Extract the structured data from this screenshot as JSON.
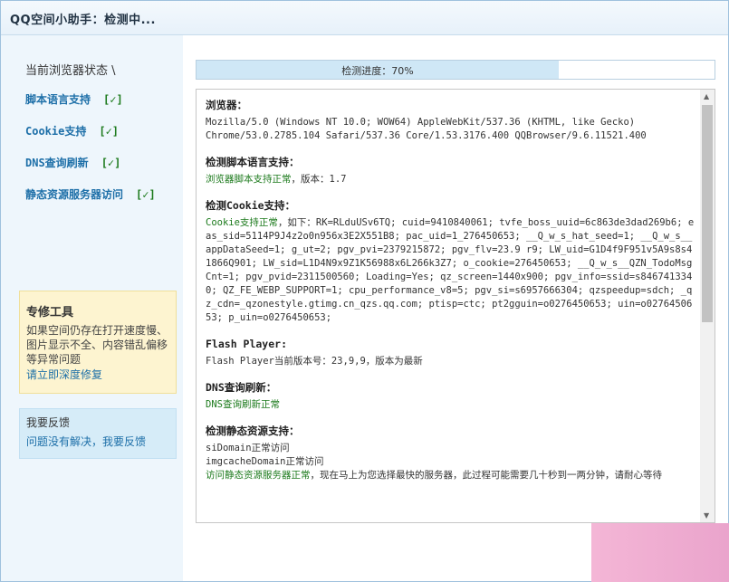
{
  "window": {
    "title": "QQ空间小助手：检测中..."
  },
  "sidebar": {
    "header": "当前浏览器状态 \\",
    "items": [
      {
        "label": "脚本语言支持",
        "status": "[✓]"
      },
      {
        "label": "Cookie支持",
        "status": "[✓]"
      },
      {
        "label": "DNS查询刷新",
        "status": "[✓]"
      },
      {
        "label": "静态资源服务器访问",
        "status": "[✓]"
      }
    ],
    "tools_box": {
      "title": "专修工具",
      "desc": "如果空间仍存在打开速度慢、图片显示不全、内容错乱偏移等异常问题",
      "link": "请立即深度修复"
    },
    "feedback_box": {
      "title": "我要反馈",
      "link": "问题没有解决，我要反馈"
    }
  },
  "progress": {
    "label": "检测进度：70%",
    "value": 0.7
  },
  "report": {
    "browser": {
      "heading": "浏览器：",
      "line1": "Mozilla/5.0 (Windows NT 10.0; WOW64) AppleWebKit/537.36 (KHTML, like Gecko)",
      "line2": "Chrome/53.0.2785.104 Safari/537.36 Core/1.53.3176.400 QQBrowser/9.6.11521.400"
    },
    "script": {
      "heading": "检测脚本语言支持：",
      "ok": "浏览器脚本支持正常",
      "rest": "，版本：1.7"
    },
    "cookie": {
      "heading": "检测Cookie支持：",
      "ok": "Cookie支持正常",
      "rest": "，如下：RK=RLduUSv6TQ; cuid=9410840061; tvfe_boss_uuid=6c863de3dad269b6; eas_sid=5114P9J4z2o0n956x3E2X551B8; pac_uid=1_276450653; __Q_w_s_hat_seed=1; __Q_w_s__appDataSeed=1; g_ut=2; pgv_pvi=2379215872; pgv_flv=23.9 r9; LW_uid=G1D4f9F951v5A9s8s41866Q901; LW_sid=L1D4N9x9Z1K56988x6L266k3Z7; o_cookie=276450653; __Q_w_s__QZN_TodoMsgCnt=1; pgv_pvid=2311500560; Loading=Yes; qz_screen=1440x900; pgv_info=ssid=s8467413340; QZ_FE_WEBP_SUPPORT=1; cpu_performance_v8=5; pgv_si=s6957666304; qzspeedup=sdch; _qz_cdn=_qzonestyle.gtimg.cn_qzs.qq.com; ptisp=ctc; pt2gguin=o0276450653; uin=o0276450653; p_uin=o0276450653;"
    },
    "flash": {
      "heading": "Flash Player:",
      "text": "Flash Player当前版本号：23,9,9，版本为最新"
    },
    "dns": {
      "heading": "DNS查询刷新：",
      "ok": "DNS查询刷新正常"
    },
    "static": {
      "heading": "检测静态资源支持：",
      "line1": "siDomain正常访问",
      "line2": "imgcacheDomain正常访问",
      "ok": "访问静态资源服务器正常",
      "rest": "，现在马上为您选择最快的服务器，此过程可能需要几十秒到一两分钟，请耐心等待"
    }
  },
  "colors": {
    "link": "#1d6fa8",
    "ok": "#1c7a1c",
    "progress": "#cfe7f6"
  },
  "icons": {
    "scroll_up": "triangle-up-icon",
    "scroll_down": "triangle-down-icon"
  }
}
